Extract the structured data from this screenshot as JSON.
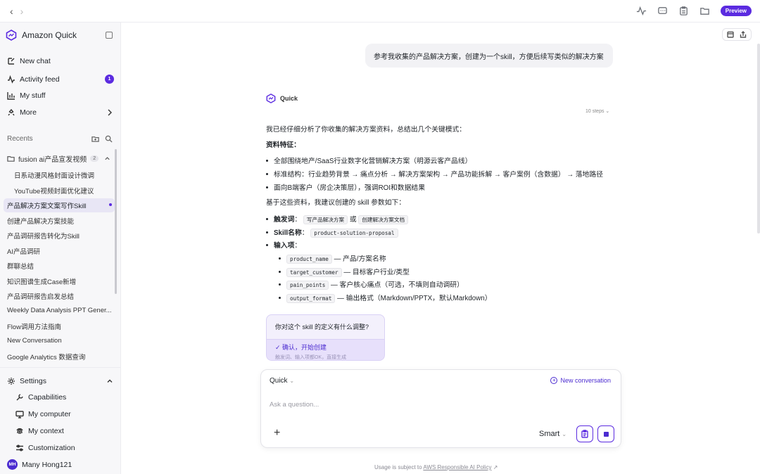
{
  "topbar": {
    "back_arrow": "‹",
    "forward_arrow": "›",
    "preview": "Preview",
    "icons": [
      "activity-icon",
      "chat-icon",
      "clipboard-icon",
      "folder-icon"
    ]
  },
  "sidebar": {
    "brand": "Amazon Quick",
    "menu": [
      {
        "label": "New chat",
        "icon": "edit-icon"
      },
      {
        "label": "Activity feed",
        "icon": "activity-icon",
        "badge": "1"
      },
      {
        "label": "My stuff",
        "icon": "bar-chart-icon"
      },
      {
        "label": "More",
        "icon": "more-icon"
      }
    ],
    "recents_label": "Recents",
    "folder": {
      "label": "fusion ai产品宣发视频",
      "count": "2"
    },
    "folder_children": [
      "日系动漫风格封面设计微调",
      "YouTube视频封面优化建议"
    ],
    "active_item": "产品解决方案文案写作Skill",
    "recents": [
      "创建产品解决方案技能",
      "产品调研报告转化为Skill",
      "AI产品调研",
      "群聊总结",
      "知识图谱生成Case新增",
      "产品调研报告启发总结",
      "Weekly Data Analysis PPT Gener...",
      "Flow调用方法指南",
      "New Conversation",
      "Google Analytics 数据查询"
    ],
    "settings": {
      "label": "Settings",
      "items": [
        "Capabilities",
        "My computer",
        "My context",
        "Customization"
      ]
    },
    "user": {
      "initials": "MH",
      "name": "Many Hong121"
    }
  },
  "conversation": {
    "user_message": "参考我收集的产品解决方案，创建为一个skill，方便后续写类似的解决方案",
    "assistant_name": "Quick",
    "steps": "10 steps",
    "answer": {
      "intro": "我已经仔细分析了你收集的解决方案资料，总结出几个关键模式：",
      "features_heading": "资料特征：",
      "features": [
        "全部围绕地产/SaaS行业数字化营销解决方案（明源云客产品线）",
        "标准结构：行业趋势背景 → 痛点分析 → 解决方案架构 → 产品功能拆解 → 客户案例（含数据） → 落地路径",
        "面向B端客户（房企决策层），强调ROI和数据结果"
      ],
      "params_intro": "基于这些资料，我建议创建的 skill 参数如下：",
      "trigger_label": "触发词",
      "trigger_colon": "：",
      "trigger_a": "写产品解决方案",
      "trigger_or": "或",
      "trigger_b": "创建解决方案文档",
      "skillname_label": "Skill名称",
      "skillname_colon": "：",
      "skillname": "product-solution-proposal",
      "inputs_label": "输入项",
      "inputs_colon": "：",
      "inputs": [
        {
          "key": "product_name",
          "desc": "— 产品/方案名称"
        },
        {
          "key": "target_customer",
          "desc": "— 目标客户行业/类型"
        },
        {
          "key": "pain_points",
          "desc": "— 客户核心痛点（可选，不填则自动调研）"
        },
        {
          "key": "output_format",
          "desc": "— 输出格式（Markdown/PPTX，默认Markdown）"
        }
      ]
    },
    "question_card": {
      "title": "你对这个 skill 的定义有什么调整?",
      "option": "✓ 确认，开始创建",
      "option_hint": "触发词、输入项都OK，直接生成"
    }
  },
  "composer": {
    "agent": "Quick",
    "new_conversation": "New conversation",
    "placeholder": "Ask a question...",
    "mode": "Smart"
  },
  "footer": {
    "prefix": "Usage is subject to",
    "link": "AWS Responsible AI Policy"
  },
  "colors": {
    "accent": "#5b2be0",
    "sidebar_bg": "#f7f7f9",
    "active_bg": "#e8e6f5"
  }
}
